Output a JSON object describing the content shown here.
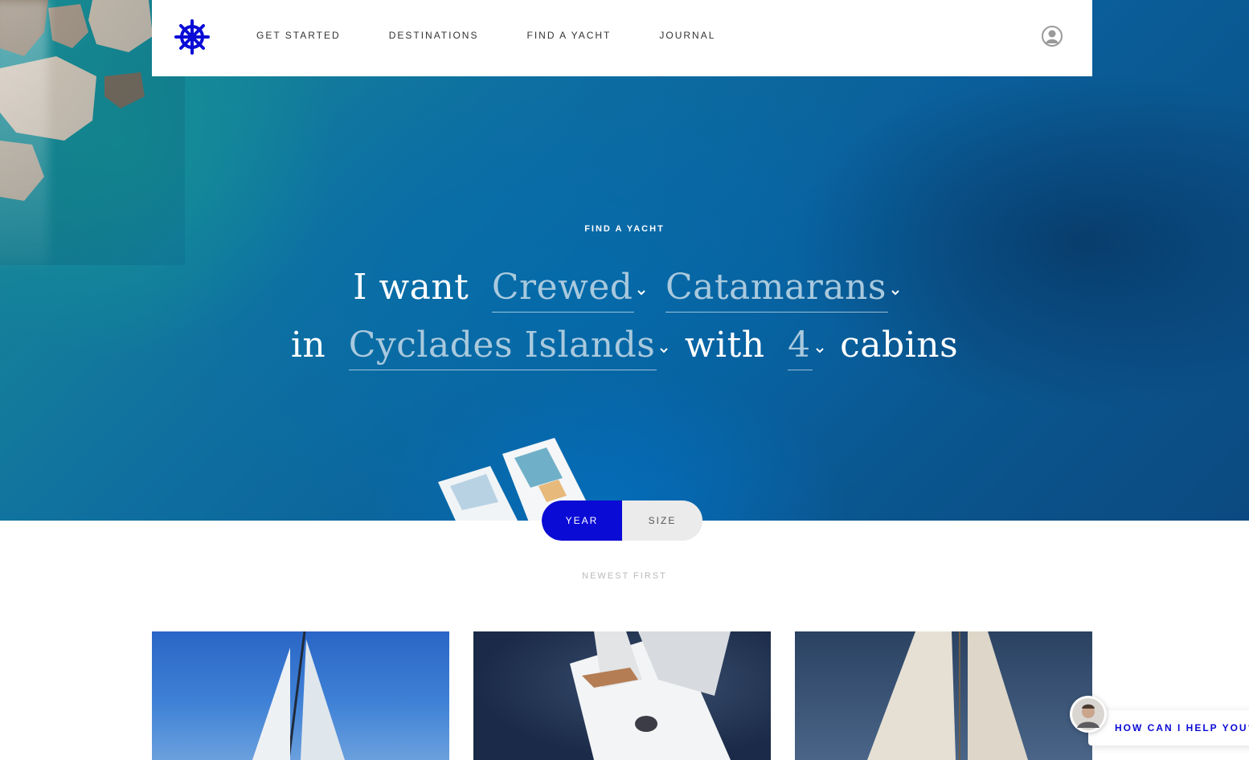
{
  "nav": {
    "logo_icon": "ship-wheel-icon",
    "brand_color": "#0b0bd6",
    "links": [
      "GET STARTED",
      "DESTINATIONS",
      "FIND A YACHT",
      "JOURNAL"
    ],
    "user_icon": "user-circle-icon"
  },
  "hero": {
    "eyebrow": "FIND A YACHT",
    "line1": {
      "prefix": "I want",
      "charter_type": "Crewed",
      "yacht_type": "Catamarans"
    },
    "line2": {
      "prefix": "in",
      "destination": "Cyclades Islands",
      "middle": "with",
      "cabins": "4",
      "suffix": "cabins"
    }
  },
  "sort": {
    "options": [
      "YEAR",
      "SIZE"
    ],
    "active": "YEAR",
    "label": "NEWEST FIRST"
  },
  "chat": {
    "label": "HOW CAN I HELP YOU?"
  }
}
